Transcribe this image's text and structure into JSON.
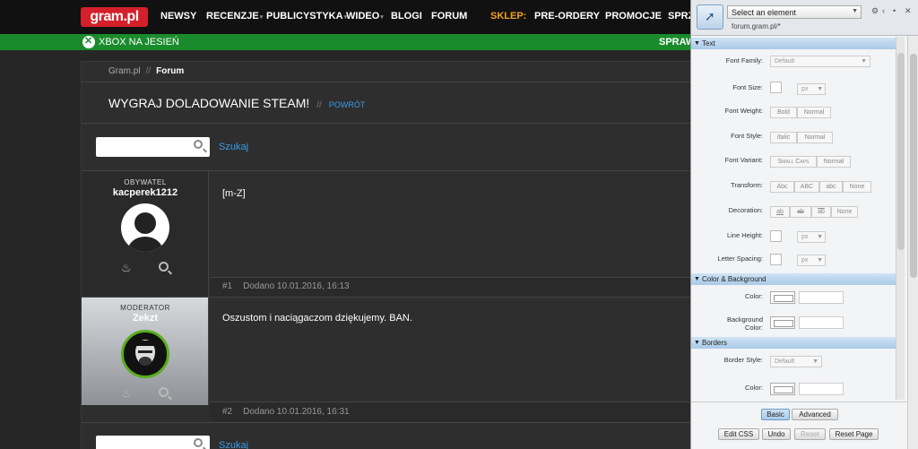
{
  "nav": {
    "logo": "gram.pl",
    "items": [
      "NEWSY",
      "RECENZJE",
      "PUBLICYSTYKA",
      "WIDEO",
      "BLOGI",
      "FORUM"
    ],
    "shop": "SKLEP:",
    "shop_items": [
      "PRE-ORDERY",
      "PROMOCJE",
      "SPRZ"
    ]
  },
  "promo": {
    "left": "XBOX NA JESIEŃ",
    "right": "SPRAW"
  },
  "breadcrumb": {
    "home": "Gram.pl",
    "sep": "//",
    "current": "Forum"
  },
  "thread": {
    "title": "WYGRAJ DOLADOWANIE STEAM!",
    "sep": "//",
    "back": "POWRÓT"
  },
  "search": {
    "button": "Szukaj",
    "placeholder": ""
  },
  "posts": [
    {
      "role": "OBYWATEL",
      "user": "kacperek1212",
      "text": "[m-Z]",
      "num": "#1",
      "meta": "Dodano 10.01.2016, 16:13"
    },
    {
      "role": "MODERATOR",
      "user": "Zekzt",
      "text": "Oszustom i naciągaczom dziękujemy. BAN.",
      "num": "#2",
      "meta": "Dodano 10.01.2016, 16:31"
    }
  ],
  "editor": {
    "select_label": "Select an element",
    "site": "forum.gram.pl/*",
    "sections": {
      "text": "Text",
      "color": "Color & Background",
      "borders": "Borders"
    },
    "labels": {
      "font_family": "Font Family:",
      "font_size": "Font Size:",
      "font_weight": "Font Weight:",
      "font_style": "Font Style:",
      "font_variant": "Font Variant:",
      "transform": "Transform:",
      "decoration": "Decoration:",
      "line_height": "Line Height:",
      "letter_spacing": "Letter Spacing:",
      "color": "Color:",
      "bg_color_1": "Background",
      "bg_color_2": "Color:",
      "border_style": "Border Style:",
      "border_color": "Color:"
    },
    "values": {
      "default": "Default",
      "px": "px"
    },
    "weight": [
      "Bold",
      "Normal"
    ],
    "style": [
      "Italic",
      "Normal"
    ],
    "variant": [
      "Small Caps",
      "Normal"
    ],
    "transform": [
      "Abc",
      "ABC",
      "abc",
      "None"
    ],
    "decoration": [
      "ab",
      "ab",
      "ab",
      "None"
    ],
    "tabs": [
      "Basic",
      "Advanced"
    ],
    "buttons": [
      "Edit CSS",
      "Undo",
      "Reset",
      "Reset Page"
    ]
  }
}
